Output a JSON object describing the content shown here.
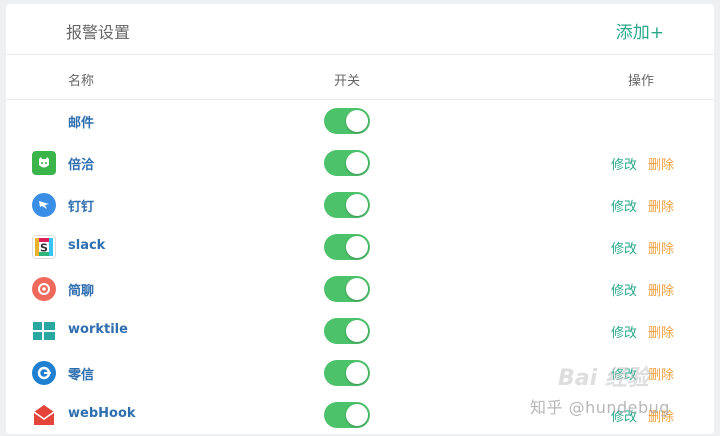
{
  "header": {
    "title": "报警设置",
    "add_label": "添加+"
  },
  "columns": {
    "name": "名称",
    "switch": "开关",
    "ops": "操作"
  },
  "rows": [
    {
      "name": "邮件",
      "icon": "none",
      "enabled": true,
      "edit": "",
      "delete": ""
    },
    {
      "name": "倍洽",
      "icon": "bearychat-icon",
      "enabled": true,
      "edit": "修改",
      "delete": "删除"
    },
    {
      "name": "钉钉",
      "icon": "dingtalk-icon",
      "enabled": true,
      "edit": "修改",
      "delete": "删除"
    },
    {
      "name": "slack",
      "icon": "slack-icon",
      "enabled": true,
      "edit": "修改",
      "delete": "删除"
    },
    {
      "name": "简聊",
      "icon": "jianliao-icon",
      "enabled": true,
      "edit": "修改",
      "delete": "删除"
    },
    {
      "name": "worktile",
      "icon": "worktile-icon",
      "enabled": true,
      "edit": "修改",
      "delete": "删除"
    },
    {
      "name": "零信",
      "icon": "pubu-icon",
      "enabled": true,
      "edit": "修改",
      "delete": "删除"
    },
    {
      "name": "webHook",
      "icon": "webhook-icon",
      "enabled": true,
      "edit": "修改",
      "delete": "删除"
    }
  ],
  "watermark": {
    "text": "知乎 @hundebug",
    "baidu": "Bai 经验"
  },
  "colors": {
    "accent": "#2aa88a",
    "toggle_on": "#4cc26a",
    "delete": "#f0a040",
    "name": "#2f6fb0"
  }
}
